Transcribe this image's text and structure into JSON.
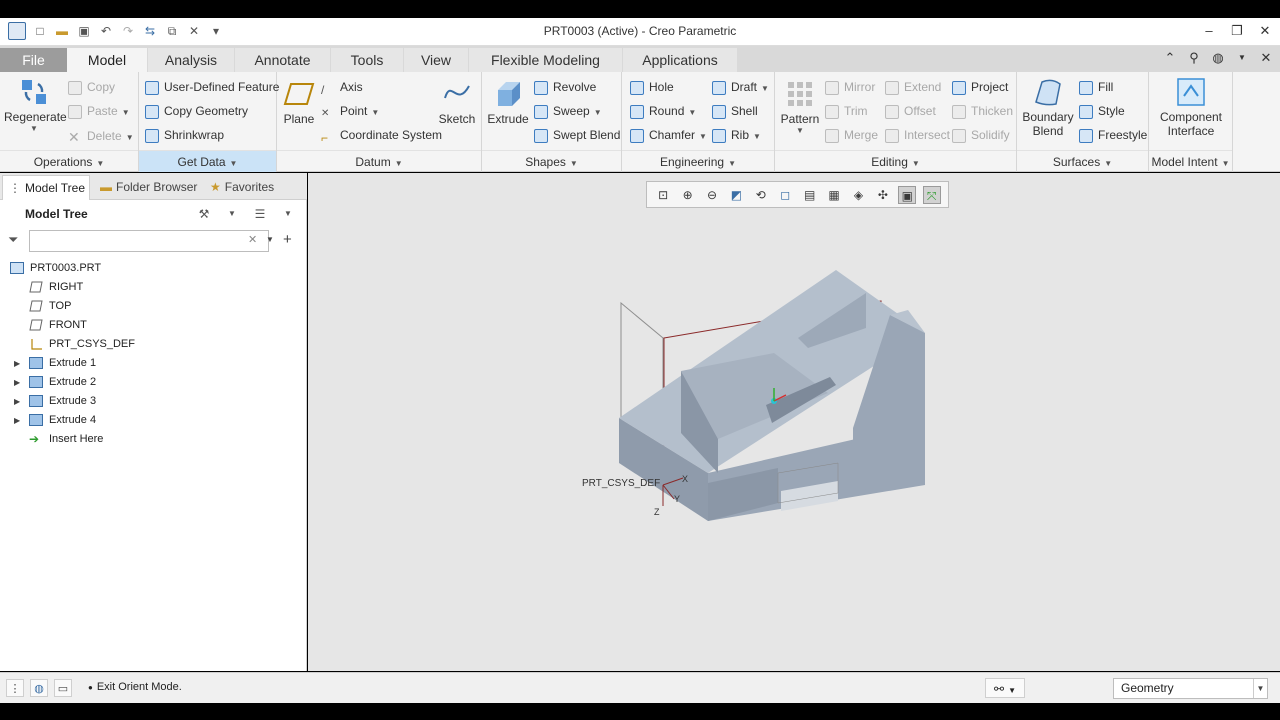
{
  "window": {
    "title": "PRT0003 (Active) - Creo Parametric",
    "controls": [
      "minimize",
      "restore",
      "close"
    ]
  },
  "quick_access": [
    "new-icon",
    "open-icon",
    "save-icon",
    "undo-icon",
    "redo-icon",
    "regenerate-icon",
    "windows-icon",
    "close-window-icon",
    "customize-icon"
  ],
  "tabs": [
    "File",
    "Model",
    "Analysis",
    "Annotate",
    "Tools",
    "View",
    "Flexible Modeling",
    "Applications"
  ],
  "active_tab": "Model",
  "ribbon": {
    "operations": {
      "label": "Operations",
      "regenerate": "Regenerate",
      "copy": "Copy",
      "paste": "Paste",
      "delete": "Delete"
    },
    "get_data": {
      "label": "Get Data",
      "udf": "User-Defined Feature",
      "copy_geometry": "Copy Geometry",
      "shrinkwrap": "Shrinkwrap"
    },
    "datum": {
      "label": "Datum",
      "plane": "Plane",
      "axis": "Axis",
      "point": "Point",
      "csys": "Coordinate System",
      "sketch": "Sketch"
    },
    "shapes": {
      "label": "Shapes",
      "extrude": "Extrude",
      "revolve": "Revolve",
      "sweep": "Sweep",
      "swept_blend": "Swept Blend"
    },
    "engineering": {
      "label": "Engineering",
      "hole": "Hole",
      "round": "Round",
      "chamfer": "Chamfer",
      "draft": "Draft",
      "shell": "Shell",
      "rib": "Rib"
    },
    "editing": {
      "label": "Editing",
      "pattern": "Pattern",
      "mirror": "Mirror",
      "trim": "Trim",
      "merge": "Merge",
      "extend": "Extend",
      "offset": "Offset",
      "intersect": "Intersect",
      "project": "Project",
      "thicken": "Thicken",
      "solidify": "Solidify"
    },
    "surfaces": {
      "label": "Surfaces",
      "boundary_blend_1": "Boundary",
      "boundary_blend_2": "Blend",
      "fill": "Fill",
      "style": "Style",
      "freestyle": "Freestyle"
    },
    "model_intent": {
      "label": "Model Intent",
      "component_interface_1": "Component",
      "component_interface_2": "Interface"
    }
  },
  "left_panel": {
    "tabs": [
      "Model Tree",
      "Folder Browser",
      "Favorites"
    ],
    "title": "Model Tree",
    "search_value": "",
    "tree": [
      {
        "label": "PRT0003.PRT",
        "icon": "part-icon",
        "expandable": false
      },
      {
        "label": "RIGHT",
        "icon": "datum-plane-icon",
        "expandable": false
      },
      {
        "label": "TOP",
        "icon": "datum-plane-icon",
        "expandable": false
      },
      {
        "label": "FRONT",
        "icon": "datum-plane-icon",
        "expandable": false
      },
      {
        "label": "PRT_CSYS_DEF",
        "icon": "csys-icon",
        "expandable": false
      },
      {
        "label": "Extrude 1",
        "icon": "extrude-icon",
        "expandable": true
      },
      {
        "label": "Extrude 2",
        "icon": "extrude-icon",
        "expandable": true
      },
      {
        "label": "Extrude 3",
        "icon": "extrude-icon",
        "expandable": true
      },
      {
        "label": "Extrude 4",
        "icon": "extrude-icon",
        "expandable": true
      },
      {
        "label": "Insert Here",
        "icon": "insert-arrow-icon",
        "expandable": false
      }
    ]
  },
  "viewport": {
    "csys_label": "PRT_CSYS_DEF",
    "axis_x": "X",
    "axis_y": "Y",
    "axis_z": "Z",
    "model_color": "#a9b4c2",
    "bbox_color": "#8b2a2a"
  },
  "status": {
    "message": "Exit Orient Mode.",
    "filter_value": "Geometry"
  }
}
